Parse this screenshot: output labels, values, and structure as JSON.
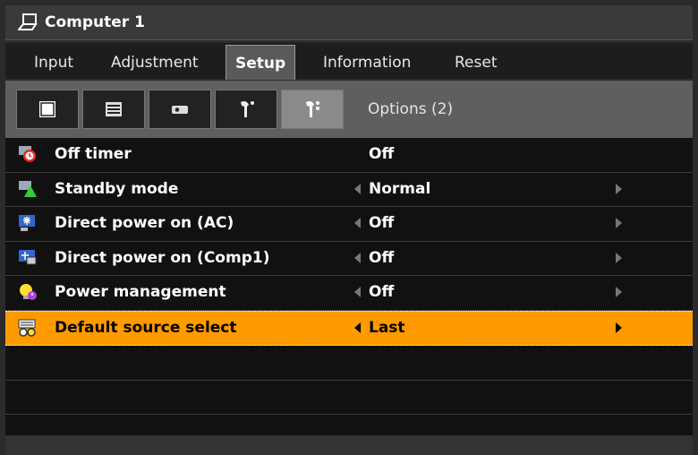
{
  "window": {
    "title": "Computer 1",
    "icon": "computer-icon"
  },
  "tabs": [
    {
      "label": "Input",
      "active": false
    },
    {
      "label": "Adjustment",
      "active": false
    },
    {
      "label": "Setup",
      "active": true
    },
    {
      "label": "Information",
      "active": false
    },
    {
      "label": "Reset",
      "active": false
    }
  ],
  "subtabs": {
    "icons": [
      "general-icon",
      "menu-icon",
      "installation-icon",
      "options1-icon",
      "options2-icon"
    ],
    "selected_index": 4,
    "current_label": "Options (2)"
  },
  "settings": [
    {
      "label": "Off timer",
      "value": "Off",
      "icon": "off-timer-icon",
      "arrows": false
    },
    {
      "label": "Standby mode",
      "value": "Normal",
      "icon": "standby-icon",
      "arrows": true
    },
    {
      "label": "Direct power on (AC)",
      "value": "Off",
      "icon": "direct-power-ac-icon",
      "arrows": true
    },
    {
      "label": "Direct power on (Comp1)",
      "value": "Off",
      "icon": "direct-power-comp-icon",
      "arrows": true
    },
    {
      "label": "Power management",
      "value": "Off",
      "icon": "power-management-icon",
      "arrows": true
    },
    {
      "label": "Default source select",
      "value": "Last",
      "icon": "default-source-icon",
      "arrows": true,
      "highlighted": true
    }
  ],
  "colors": {
    "highlight": "#ff9a00",
    "background": "#111111",
    "tab_bar": "#1d1d1d",
    "icon_bar": "#5f5f5f"
  }
}
